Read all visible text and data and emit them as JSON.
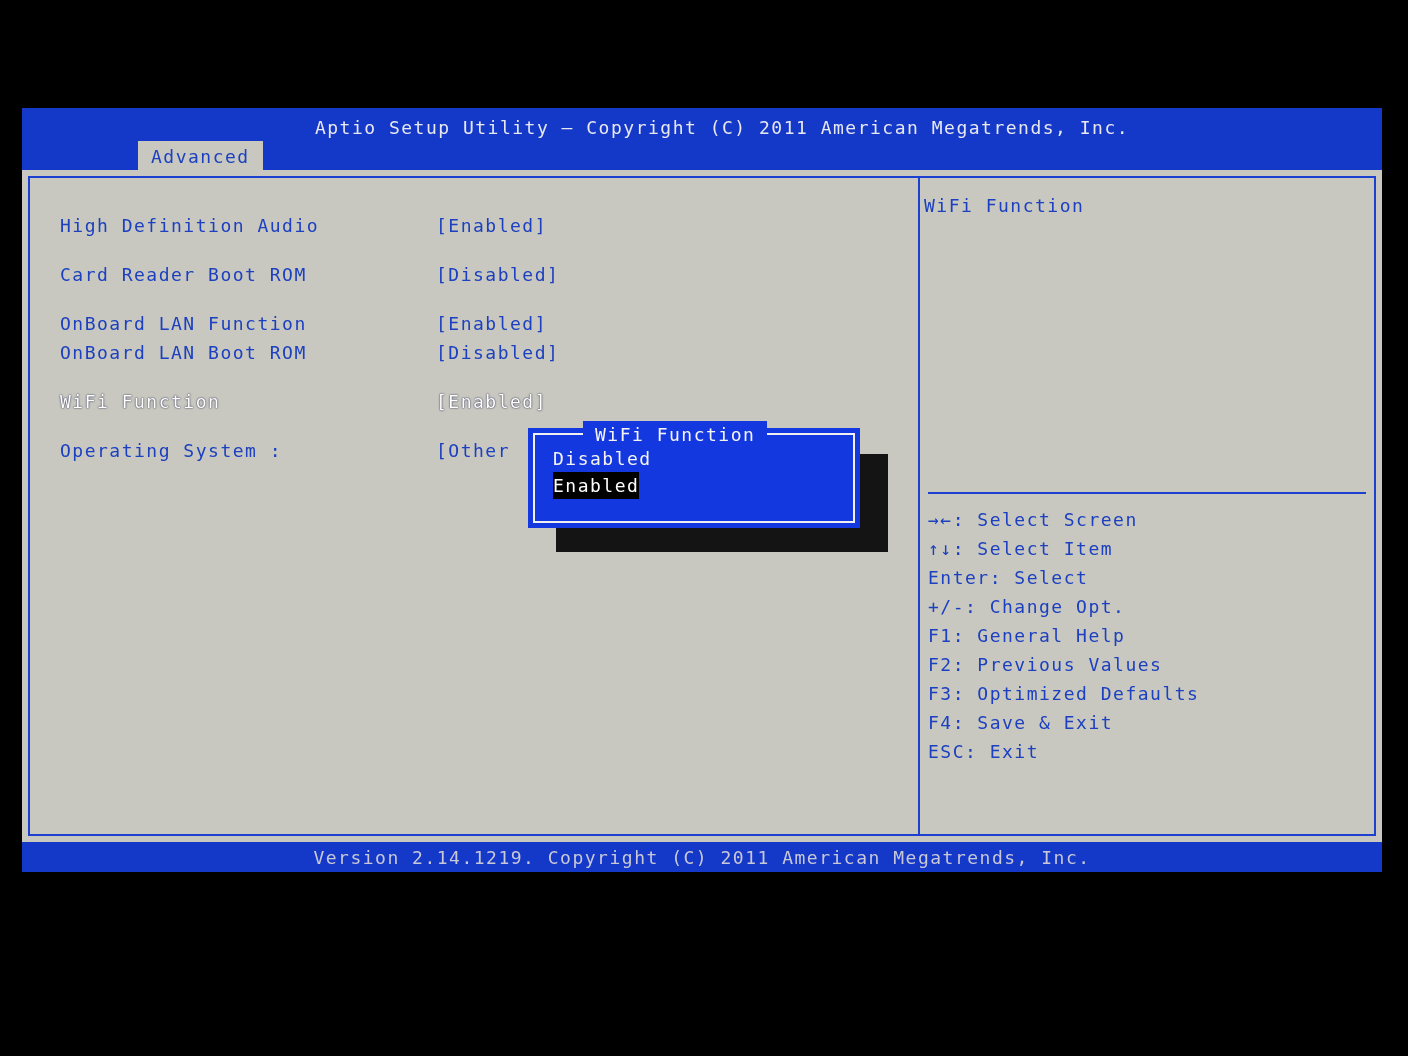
{
  "header": {
    "title": "Aptio Setup Utility – Copyright (C) 2011 American Megatrends, Inc.",
    "tabs": [
      {
        "label": "Advanced",
        "selected": true
      }
    ]
  },
  "settings": [
    {
      "items": [
        {
          "label": "High Definition Audio",
          "value": "[Enabled]",
          "selected": false
        }
      ]
    },
    {
      "items": [
        {
          "label": "Card Reader Boot ROM",
          "value": "[Disabled]",
          "selected": false
        }
      ]
    },
    {
      "items": [
        {
          "label": "OnBoard LAN Function",
          "value": "[Enabled]",
          "selected": false
        },
        {
          "label": "OnBoard LAN Boot ROM",
          "value": "[Disabled]",
          "selected": false
        }
      ]
    },
    {
      "items": [
        {
          "label": "WiFi Function",
          "value": "[Enabled]",
          "selected": true
        }
      ]
    },
    {
      "items": [
        {
          "label": "Operating System :",
          "value": "[Other",
          "selected": false
        }
      ]
    }
  ],
  "popup": {
    "title": "WiFi Function",
    "options": [
      {
        "label": "Disabled",
        "selected": false
      },
      {
        "label": "Enabled",
        "selected": true
      }
    ]
  },
  "help": {
    "title": "WiFi Function",
    "keys": [
      "→←: Select Screen",
      "↑↓: Select Item",
      "Enter: Select",
      "+/-: Change Opt.",
      "F1: General Help",
      "F2: Previous Values",
      "F3: Optimized Defaults",
      "F4: Save & Exit",
      "ESC: Exit"
    ]
  },
  "footer": "Version 2.14.1219. Copyright (C) 2011 American Megatrends, Inc."
}
